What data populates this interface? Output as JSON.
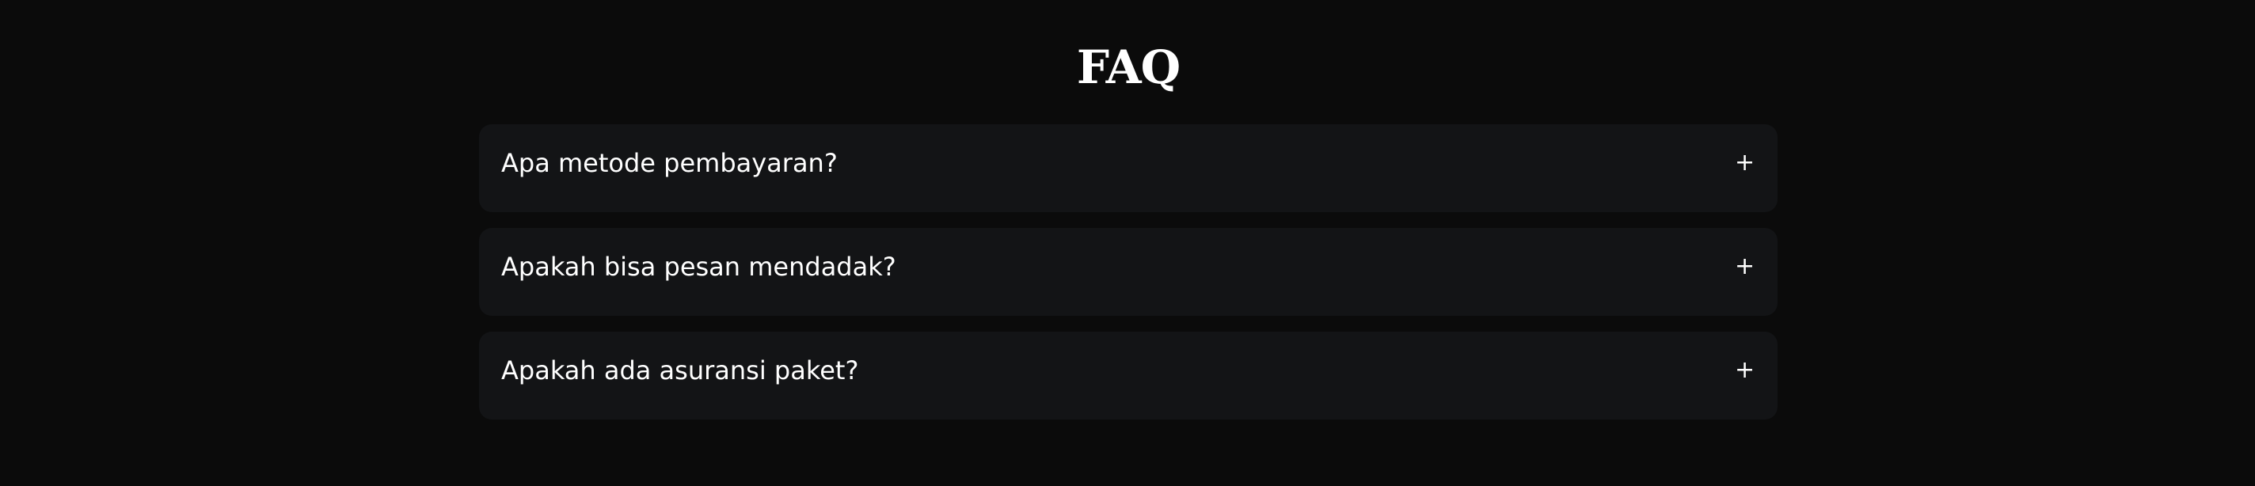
{
  "faq": {
    "title": "FAQ",
    "items": [
      {
        "question": "Apa metode pembayaran?",
        "toggle": "+"
      },
      {
        "question": "Apakah bisa pesan mendadak?",
        "toggle": "+"
      },
      {
        "question": "Apakah ada asuransi paket?",
        "toggle": "+"
      }
    ]
  },
  "colors": {
    "background": "#0b0b0b",
    "card": "#131416",
    "text": "#ffffff"
  },
  "icons": {
    "toggle": "plus-icon"
  }
}
